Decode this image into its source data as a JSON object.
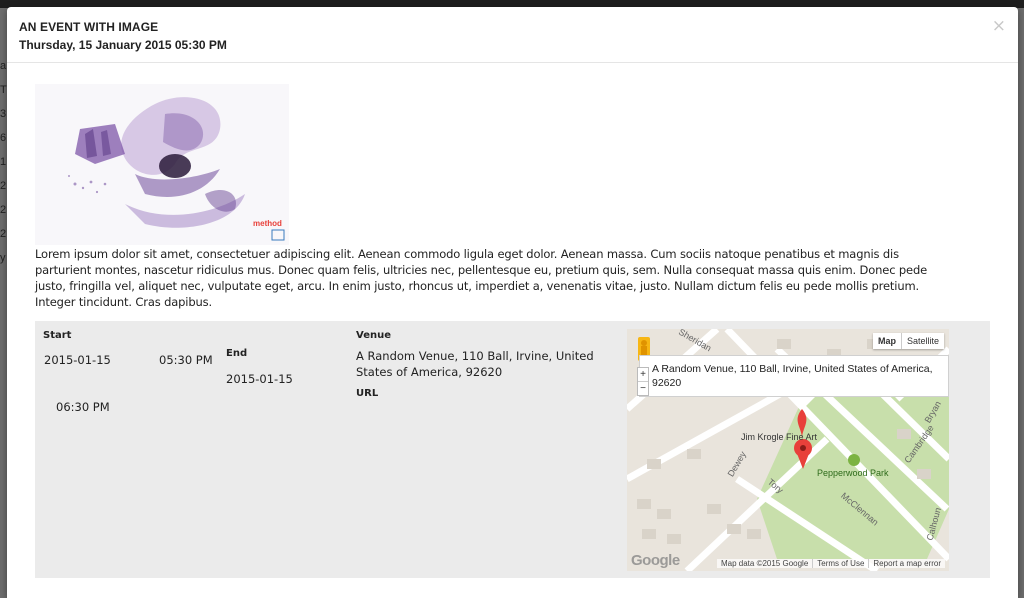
{
  "modal": {
    "title": "AN EVENT WITH IMAGE",
    "subtitle": "Thursday, 15 January 2015 05:30 PM",
    "close_glyph": "×",
    "close_icon": "close-icon"
  },
  "image": {
    "brand_text": "method",
    "icon": "event-artwork-image"
  },
  "description": "Lorem ipsum dolor sit amet, consectetuer adipiscing elit. Aenean commodo ligula eget dolor. Aenean massa. Cum sociis natoque penatibus et magnis dis parturient montes, nascetur ridiculus mus. Donec quam felis, ultricies nec, pellentesque eu, pretium quis, sem. Nulla consequat massa quis enim. Donec pede justo, fringilla vel, aliquet nec, vulputate eget, arcu. In enim justo, rhoncus ut, imperdiet a, venenatis vitae, justo. Nullam dictum felis eu pede mollis pretium. Integer tincidunt. Cras dapibus.",
  "details": {
    "start_label": "Start",
    "start_date": "2015-01-15",
    "start_time": "05:30 PM",
    "end_label": "End",
    "end_date": "2015-01-15",
    "end_time": "06:30 PM",
    "venue_label": "Venue",
    "venue_value": "A Random Venue, 110 Ball, Irvine, United States of America, 92620",
    "url_label": "URL"
  },
  "map": {
    "type_map": "Map",
    "type_satellite": "Satellite",
    "zoom_in": "+",
    "zoom_out": "−",
    "info_text": "A Random Venue, 110 Ball, Irvine, United States of America, 92620",
    "marker_label": "Jim Krogle Fine Art",
    "park_label": "Pepperwood Park",
    "streets": [
      "Sheridan",
      "Dewey",
      "Tory",
      "McClennan",
      "Cambridge",
      "Calhoun",
      "Bryan"
    ],
    "footer_data": "Map data ©2015 Google",
    "footer_terms": "Terms of Use",
    "footer_report": "Report a map error",
    "logo_text": "Google",
    "colors": {
      "park": "#c8dfab",
      "road": "#ffffff",
      "land": "#e9e4dc",
      "marker": "#e8403a"
    }
  },
  "backdrop": {
    "side_chars": [
      "a",
      "T",
      "3",
      "6",
      "1",
      "2",
      "2",
      "2",
      "y"
    ]
  }
}
